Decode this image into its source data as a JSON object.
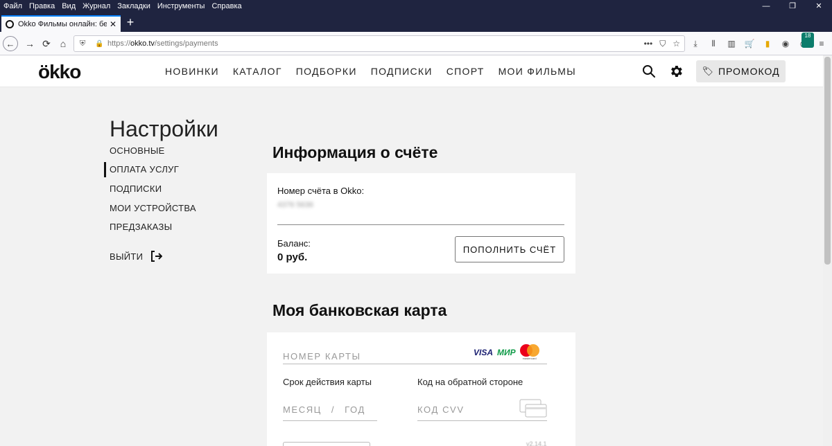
{
  "browser": {
    "menu": [
      "Файл",
      "Правка",
      "Вид",
      "Журнал",
      "Закладки",
      "Инструменты",
      "Справка"
    ],
    "window_controls": [
      "—",
      "❐",
      "✕"
    ],
    "tab": {
      "title": "Okko Фильмы онлайн: без ре",
      "close": "✕"
    },
    "newtab": "+",
    "nav": {
      "back": "←",
      "forward": "→",
      "reload": "⟳",
      "home": "⌂"
    },
    "url": {
      "scheme": "https://",
      "host": "okko.tv",
      "path": "/settings/payments"
    },
    "url_icons": [
      "•••",
      "⛉",
      "☆"
    ],
    "toolbar_icons": [
      "⤓",
      "⫴",
      "▥",
      "🛒",
      "▮",
      "◉",
      "◍",
      "≡"
    ],
    "addon_badge": "18"
  },
  "site": {
    "logo": "ökko",
    "nav": [
      "НОВИНКИ",
      "КАТАЛОГ",
      "ПОДБОРКИ",
      "ПОДПИСКИ",
      "СПОРТ",
      "МОИ ФИЛЬМЫ"
    ],
    "promo_label": "ПРОМОКОД"
  },
  "settings": {
    "title": "Настройки",
    "menu": [
      "ОСНОВНЫЕ",
      "ОПЛАТА УСЛУГ",
      "ПОДПИСКИ",
      "МОИ УСТРОЙСТВА",
      "ПРЕДЗАКАЗЫ"
    ],
    "active_item": "ОПЛАТА УСЛУГ",
    "logout": "ВЫЙТИ"
  },
  "account": {
    "heading": "Информация о счёте",
    "number_label": "Номер счёта в Okko:",
    "number_value": "4376 5636",
    "balance_label": "Баланс:",
    "balance_value": "0 руб.",
    "topup_label": "ПОПОЛНИТЬ СЧЁТ"
  },
  "bank_card": {
    "heading": "Моя банковская карта",
    "number_placeholder": "НОМЕР КАРТЫ",
    "brands": [
      "VISA",
      "МИР"
    ],
    "mastercard_caption": "mastercard",
    "expiry_label": "Срок действия карты",
    "month_placeholder": "МЕСЯЦ",
    "separator": "/",
    "year_placeholder": "ГОД",
    "cvv_label": "Код на обратной стороне",
    "cvv_placeholder": "КОД CVV",
    "version": "v2.14.1"
  },
  "colors": {
    "chrome": "#1f2440",
    "accent": "#0a84ff",
    "page_bg": "#f2f2f2"
  }
}
